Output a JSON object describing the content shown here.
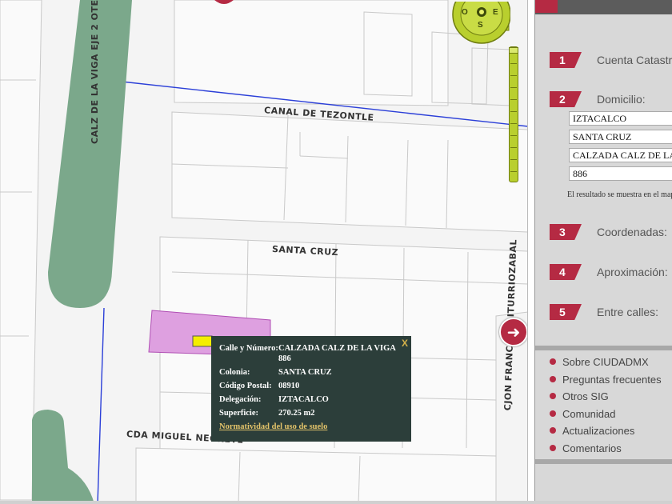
{
  "colors": {
    "accent": "#b52a43",
    "popup_bg": "#2c3e3a",
    "avenue": "#7ba88b",
    "parcel": "#dea0e0",
    "zoom": "#b9cf2e"
  },
  "map": {
    "streets": {
      "calz_viga": "CALZ DE LA VIGA EJE 2 OTE",
      "canal": "CANAL DE TEZONTLE",
      "santa_cruz": "SANTA CRUZ",
      "cjon": "CJON FRANCISCO ITURRIOZABAL",
      "cda": "CDA MIGUEL NEGRETE"
    },
    "compass": {
      "west": "O",
      "east": "E",
      "south": "S"
    },
    "popup": {
      "close": "X",
      "calle_key": "Calle y Número:",
      "calle_value": "CALZADA CALZ DE LA VIGA 886",
      "colonia_key": "Colonia:",
      "colonia_value": "SANTA CRUZ",
      "cp_key": "Código Postal:",
      "cp_value": "08910",
      "delegacion_key": "Delegación:",
      "delegacion_value": "IZTACALCO",
      "superficie_key": "Superficie:",
      "superficie_value": "270.25 m2",
      "link": "Normatividad del uso de suelo"
    }
  },
  "panel": {
    "steps": [
      {
        "num": "1",
        "label": "Cuenta Catastral:"
      },
      {
        "num": "2",
        "label": "Domicilio:"
      },
      {
        "num": "3",
        "label": "Coordenadas:"
      },
      {
        "num": "4",
        "label": "Aproximación:"
      },
      {
        "num": "5",
        "label": "Entre calles:"
      }
    ],
    "address": {
      "delegacion": "IZTACALCO",
      "colonia": "SANTA CRUZ",
      "calle": "CALZADA CALZ DE LA VIGA",
      "numero": "886"
    },
    "result_note": "El resultado se muestra en el mapa",
    "links": [
      "Sobre CIUDADMX",
      "Preguntas frecuentes",
      "Otros SIG",
      "Comunidad",
      "Actualizaciones",
      "Comentarios"
    ]
  }
}
